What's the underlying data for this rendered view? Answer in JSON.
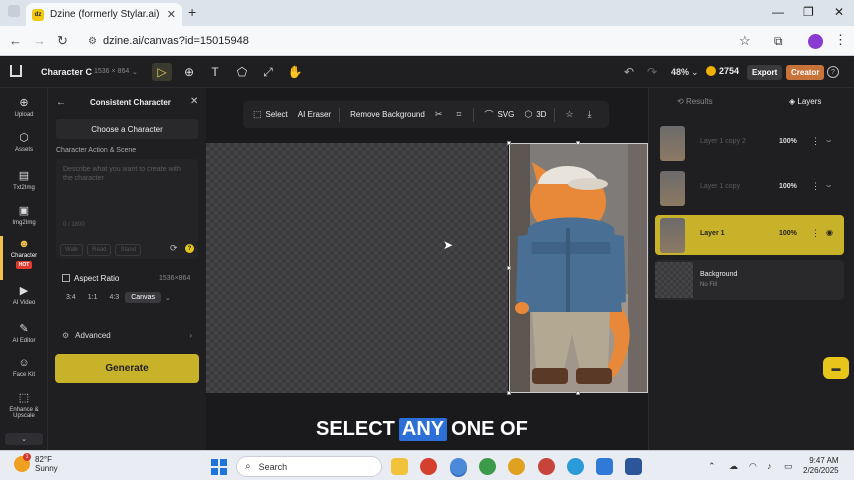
{
  "browser": {
    "tab_title": "Dzine (formerly Stylar.ai) - The",
    "favicon_text": "dz",
    "url": "dzine.ai/canvas?id=15015948"
  },
  "apptop": {
    "project_name": "Character C",
    "project_size": "1536 × 864",
    "zoom": "48%",
    "credits": "2754",
    "export_label": "Export",
    "creator_label": "Creator"
  },
  "rail": {
    "items": [
      {
        "label": "Upload",
        "icon": "upload-icon"
      },
      {
        "label": "Assets",
        "icon": "assets-icon"
      },
      {
        "label": "Txt2Img",
        "icon": "txt2img-icon"
      },
      {
        "label": "Img2Img",
        "icon": "img2img-icon"
      },
      {
        "label": "Character",
        "icon": "character-icon"
      },
      {
        "label": "AI Video",
        "icon": "video-icon"
      },
      {
        "label": "AI Editor",
        "icon": "editor-icon"
      },
      {
        "label": "Face Kit",
        "icon": "face-icon"
      },
      {
        "label": "Enhance &",
        "icon": "enhance-icon"
      },
      {
        "label": "Upscale",
        "icon": ""
      }
    ],
    "hot_badge": "HOT"
  },
  "panel": {
    "title": "Consistent Character",
    "choose_label": "Choose a Character",
    "section_label": "Character Action & Scene",
    "placeholder": "Describe what you want to create with the character",
    "counter": "0 / 1800",
    "chips": [
      "Walk",
      "Read",
      "Stand"
    ],
    "aspect_label": "Aspect Ratio",
    "aspect_size": "1536×864",
    "ratios": [
      "3:4",
      "1:1",
      "4:3",
      "Canvas"
    ],
    "selected_ratio": "Canvas",
    "advanced_label": "Advanced",
    "generate_label": "Generate"
  },
  "toolbar": {
    "select": "Select",
    "ai_eraser": "AI Eraser",
    "remove_bg": "Remove Background",
    "svg": "SVG",
    "three_d": "3D"
  },
  "subtitle": {
    "before": "SELECT",
    "highlight": "ANY",
    "after": "ONE OF"
  },
  "layers_panel": {
    "tab_results": "Results",
    "tab_layers": "Layers",
    "layers": [
      {
        "name": "Layer 1 copy 2",
        "opacity": "100%",
        "selected": false
      },
      {
        "name": "Layer 1 copy",
        "opacity": "100%",
        "selected": false
      },
      {
        "name": "Layer 1",
        "opacity": "100%",
        "selected": true
      }
    ],
    "background": {
      "name": "Background",
      "sub": "No Fill"
    }
  },
  "taskbar": {
    "temp": "82°F",
    "weather": "Sunny",
    "weather_badge": "1",
    "search": "Search",
    "time": "9:47 AM",
    "date": "2/26/2025"
  },
  "colors": {
    "accent": "#c8b22a",
    "creator": "#c8733a",
    "highlight": "#2c6fd6"
  }
}
